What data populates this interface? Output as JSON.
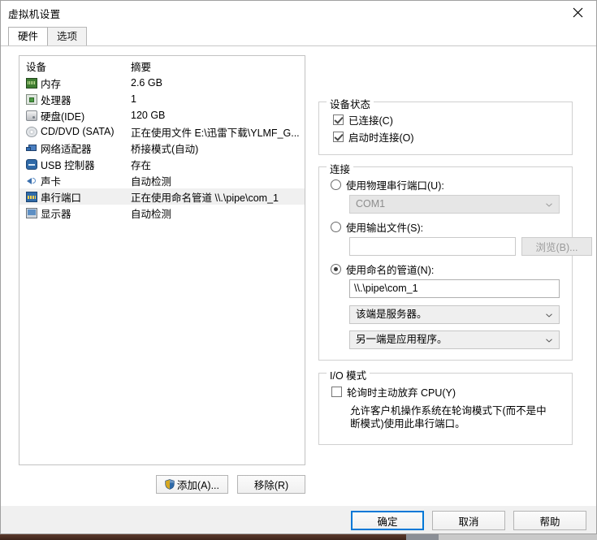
{
  "window": {
    "title": "虚拟机设置",
    "close_icon": "close-icon"
  },
  "tabs": [
    {
      "label": "硬件",
      "active": true
    },
    {
      "label": "选项",
      "active": false
    }
  ],
  "device_list": {
    "headers": {
      "device": "设备",
      "summary": "摘要"
    },
    "rows": [
      {
        "icon": "memory-icon",
        "name": "内存",
        "summary": "2.6 GB"
      },
      {
        "icon": "processor-icon",
        "name": "处理器",
        "summary": "1"
      },
      {
        "icon": "hard-disk-icon",
        "name": "硬盘(IDE)",
        "summary": "120 GB"
      },
      {
        "icon": "cd-dvd-icon",
        "name": "CD/DVD (SATA)",
        "summary": "正在使用文件 E:\\迅雷下载\\YLMF_G..."
      },
      {
        "icon": "network-adapter-icon",
        "name": "网络适配器",
        "summary": "桥接模式(自动)"
      },
      {
        "icon": "usb-controller-icon",
        "name": "USB 控制器",
        "summary": "存在"
      },
      {
        "icon": "sound-card-icon",
        "name": "声卡",
        "summary": "自动检测"
      },
      {
        "icon": "serial-port-icon",
        "name": "串行端口",
        "summary": "正在使用命名管道 \\\\.\\pipe\\com_1"
      },
      {
        "icon": "display-icon",
        "name": "显示器",
        "summary": "自动检测"
      }
    ],
    "selected_index": 7
  },
  "list_buttons": {
    "add": "添加(A)...",
    "remove": "移除(R)"
  },
  "device_status": {
    "legend": "设备状态",
    "connected": {
      "label": "已连接(C)",
      "checked": true
    },
    "connect_at_power_on": {
      "label": "启动时连接(O)",
      "checked": true
    }
  },
  "connection": {
    "legend": "连接",
    "use_physical_port": {
      "label": "使用物理串行端口(U):",
      "selected": false
    },
    "physical_port_value": "COM1",
    "use_output_file": {
      "label": "使用输出文件(S):",
      "selected": false
    },
    "output_file_value": "",
    "browse_button": "浏览(B)...",
    "use_named_pipe": {
      "label": "使用命名的管道(N):",
      "selected": true
    },
    "named_pipe_value": "\\\\.\\pipe\\com_1",
    "end_role": "该端是服务器。",
    "other_end_role": "另一端是应用程序。"
  },
  "io_mode": {
    "legend": "I/O 模式",
    "yield_cpu": {
      "label": "轮询时主动放弃 CPU(Y)",
      "checked": false
    },
    "help": "允许客户机操作系统在轮询模式下(而不是中断模式)使用此串行端口。"
  },
  "footer": {
    "ok": "确定",
    "cancel": "取消",
    "help": "帮助"
  },
  "colors": {
    "accent": "#0078d7",
    "window_bg": "#f0f0f0",
    "selection": "#f0f0f0"
  }
}
